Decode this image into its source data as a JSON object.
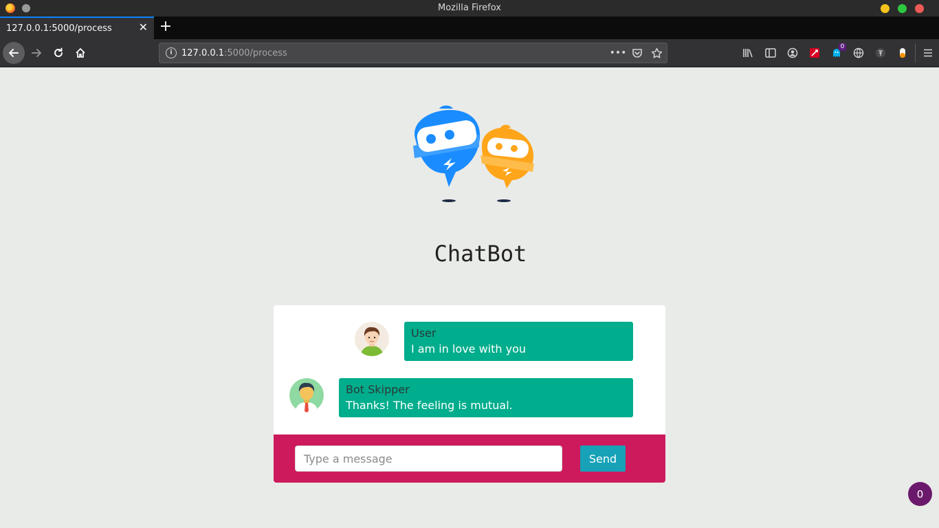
{
  "window": {
    "title": "Mozilla Firefox"
  },
  "tab": {
    "title": "127.0.0.1:5000/process",
    "close_glyph": "✕",
    "new_tab_glyph": "+"
  },
  "urlbar": {
    "host": "127.0.0.1",
    "path": ":5000/process",
    "more_glyph": "•••"
  },
  "toolbar": {
    "extension_badge": "0"
  },
  "page": {
    "title": "ChatBot"
  },
  "chat": {
    "messages": [
      {
        "sender": "User",
        "text": "I am in love with you"
      },
      {
        "sender": "Bot Skipper",
        "text": "Thanks! The feeling is mutual."
      }
    ],
    "input_placeholder": "Type a message",
    "send_label": "Send"
  },
  "floating_badge": "0",
  "colors": {
    "page_bg": "#e9ebe8",
    "bubble": "#00ad8c",
    "composer": "#cd1a5c",
    "send_button": "#17a2b8",
    "bot_blue": "#1a8cff",
    "bot_orange": "#ffa51a",
    "badge": "#6b1a6b"
  },
  "icons": [
    "firefox-icon",
    "back-arrow-icon",
    "forward-arrow-icon",
    "reload-icon",
    "home-icon",
    "info-icon",
    "more-icon",
    "pocket-icon",
    "star-icon",
    "library-icon",
    "sidebar-icon",
    "account-icon",
    "extension-icon",
    "ghost-extension-icon",
    "globe-icon",
    "translate-icon",
    "capsule-icon",
    "hamburger-menu-icon"
  ]
}
